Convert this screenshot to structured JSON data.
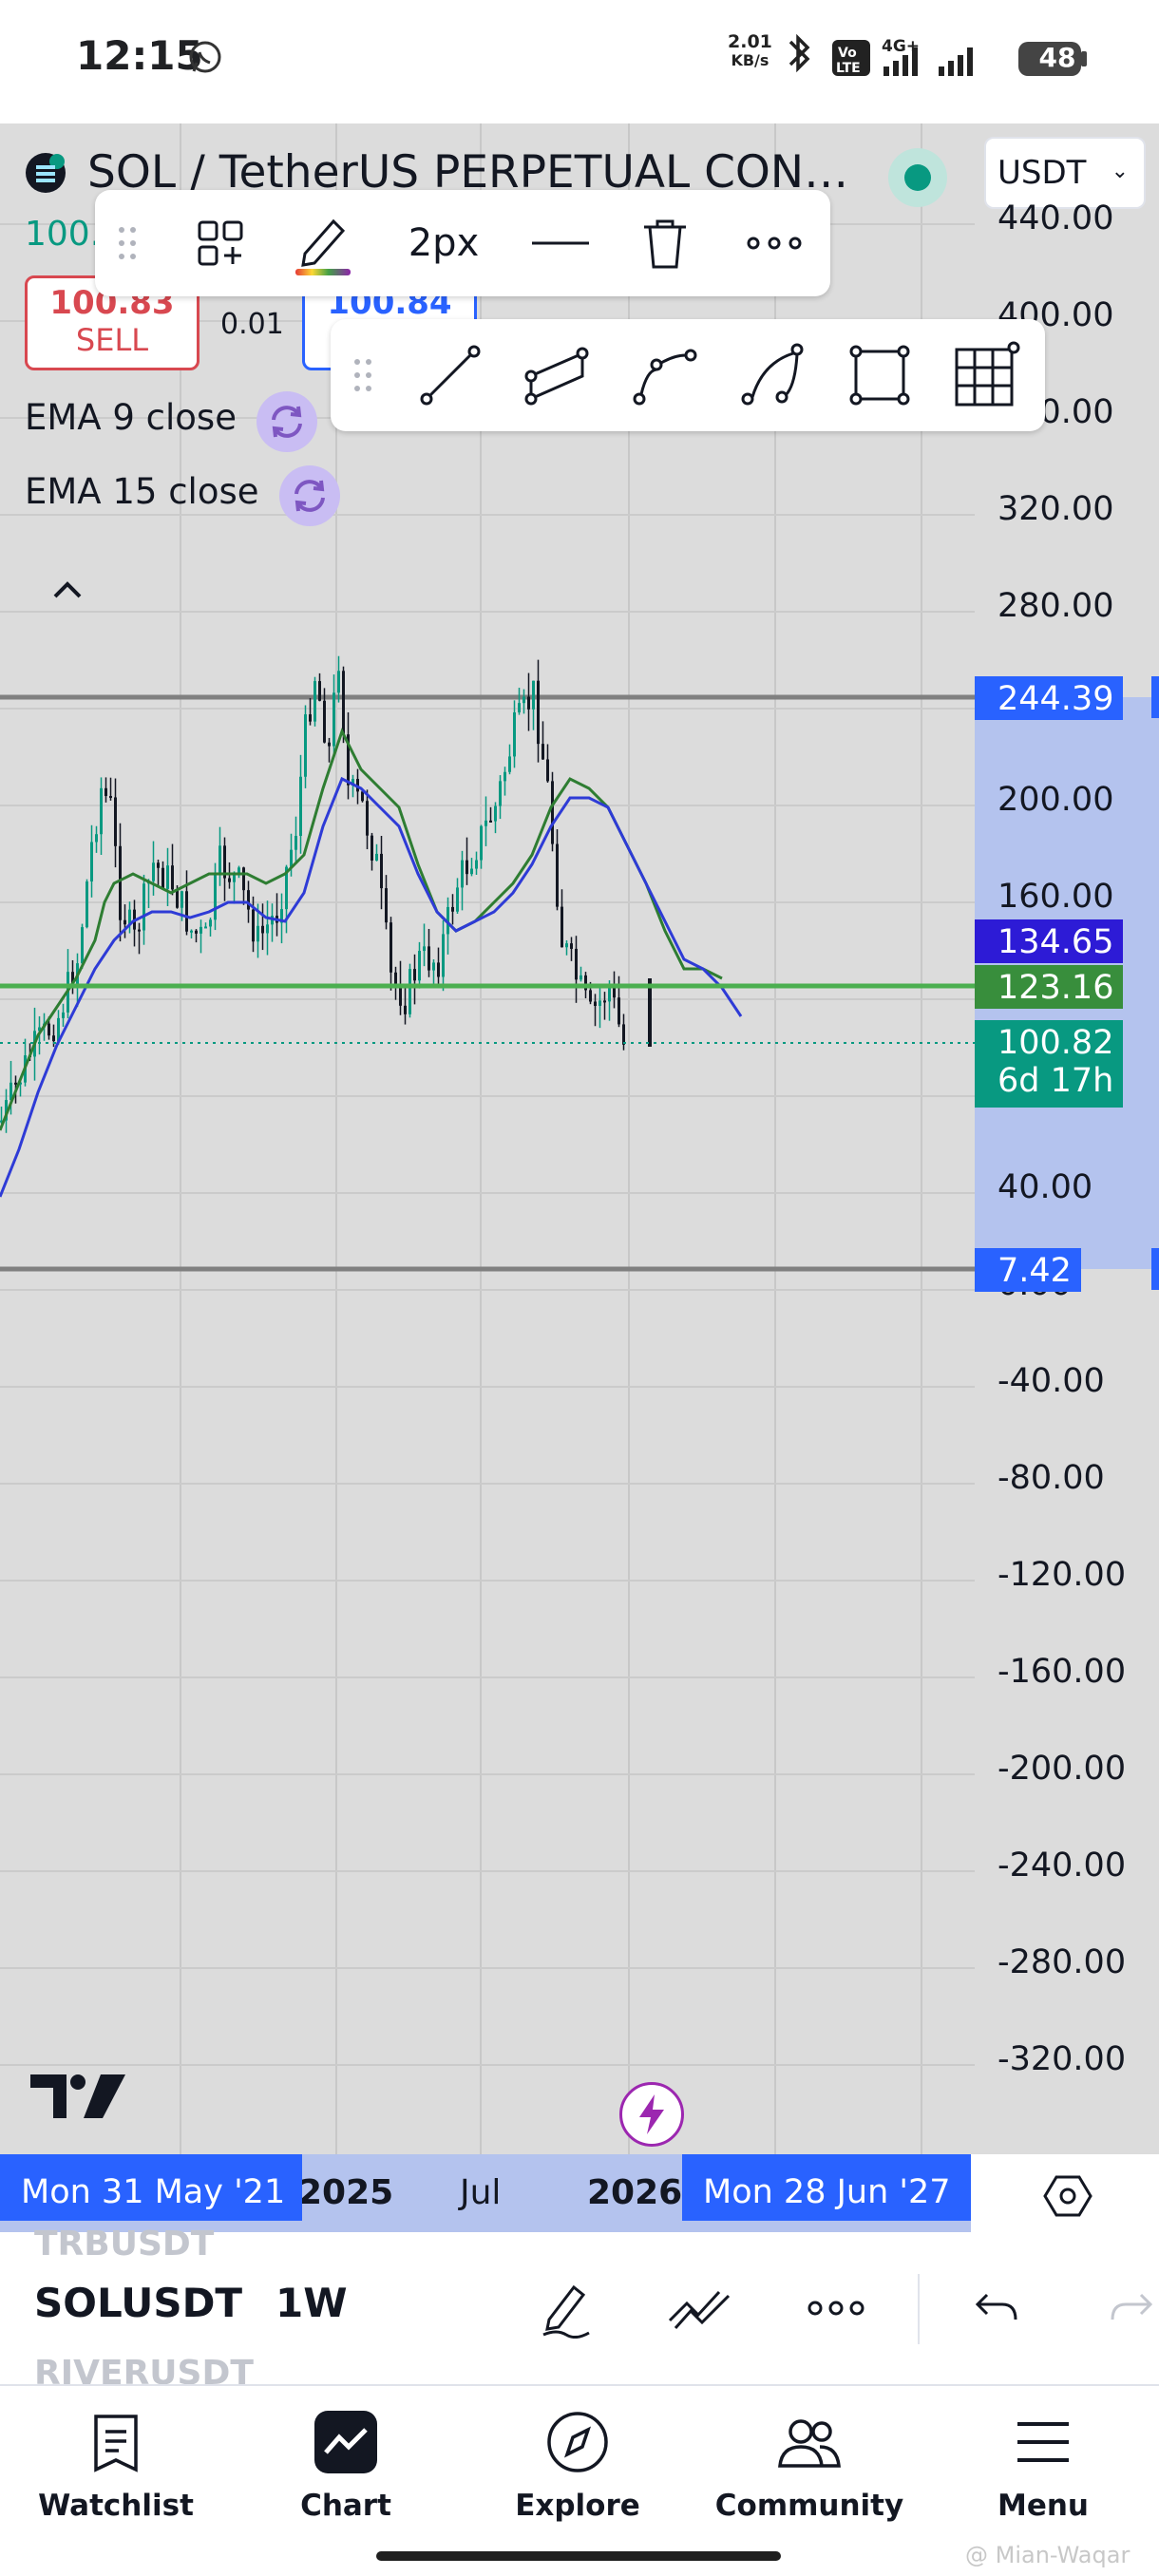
{
  "status_bar": {
    "time": "12:15",
    "net_speed_value": "2.01",
    "net_speed_unit": "KB/s",
    "volte": "Vo LTE",
    "network": "4G+",
    "battery": "48"
  },
  "header": {
    "symbol_title": "SOL / TetherUS PERPETUAL CON…",
    "currency": "USDT",
    "partial_price": "100.",
    "sell_price": "100.83",
    "sell_label": "SELL",
    "spread": "0.01",
    "buy_price": "100.84",
    "ema9": "EMA 9 close",
    "ema15": "EMA 15 close"
  },
  "toolbar": {
    "stroke_width": "2px"
  },
  "price_axis": [
    "440.00",
    "400.00",
    "360.00",
    "320.00",
    "280.00",
    "200.00",
    "160.00",
    "40.00",
    "0.00",
    "-40.00",
    "-80.00",
    "-120.00",
    "-160.00",
    "-200.00",
    "-240.00",
    "-280.00",
    "-320.00"
  ],
  "price_tags": {
    "range_high": "244.39",
    "ema_slow": "134.65",
    "hline": "123.16",
    "last_price": "100.82",
    "countdown": "6d 17h",
    "range_low": "7.42"
  },
  "time_axis": {
    "start_tag": "Mon 31 May '21",
    "label_2025": "2025",
    "label_jul": "Jul",
    "label_2026": "2026",
    "end_tag": "Mon 28 Jun '27"
  },
  "symbol_bar": {
    "ghost_top": "TRBUSDT",
    "symbol": "SOLUSDT",
    "interval": "1W",
    "ghost_bottom": "RIVERUSDT"
  },
  "nav": {
    "watchlist": "Watchlist",
    "chart": "Chart",
    "explore": "Explore",
    "community": "Community",
    "menu": "Menu"
  },
  "watermark": "@ Mian-Waqar",
  "colors": {
    "bull": "#089981",
    "bear": "#131722",
    "ema_fast": "#2e7d32",
    "ema_slow": "#2e3bd6",
    "hline": "#4caf50",
    "range_band": "#b4c3ee",
    "accent": "#2962ff",
    "sell": "#d84850"
  }
}
